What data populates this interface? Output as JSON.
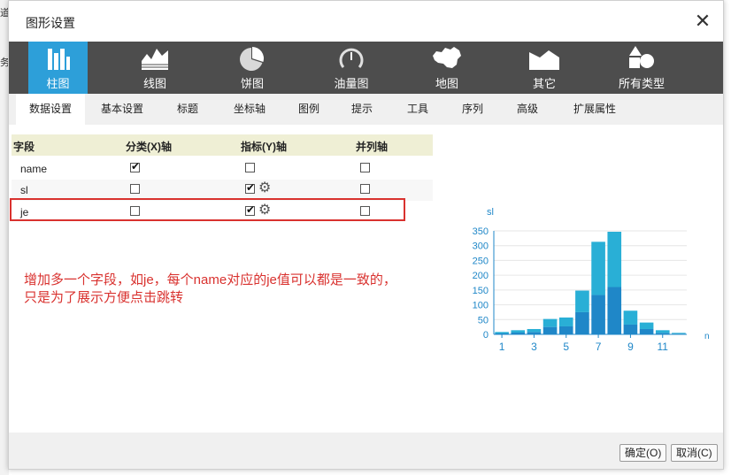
{
  "background": {
    "fragment_top": "道",
    "fragment_mid": "务"
  },
  "dialog": {
    "title": "图形设置",
    "close_icon": "close-icon",
    "chart_types": [
      {
        "label": "柱图",
        "icon": "bar-chart-icon",
        "active": true
      },
      {
        "label": "线图",
        "icon": "line-chart-icon",
        "active": false
      },
      {
        "label": "饼图",
        "icon": "pie-chart-icon",
        "active": false
      },
      {
        "label": "油量图",
        "icon": "gauge-icon",
        "active": false
      },
      {
        "label": "地图",
        "icon": "map-icon",
        "active": false
      },
      {
        "label": "其它",
        "icon": "other-chart-icon",
        "active": false
      },
      {
        "label": "所有类型",
        "icon": "all-types-icon",
        "active": false
      }
    ],
    "tabs": [
      "数据设置",
      "基本设置",
      "标题",
      "坐标轴",
      "图例",
      "提示",
      "工具",
      "序列",
      "高级",
      "扩展属性"
    ],
    "active_tab": "数据设置",
    "grid": {
      "headers": [
        "字段",
        "分类(X)轴",
        "指标(Y)轴",
        "并列轴"
      ],
      "rows": [
        {
          "field": "name",
          "x_axis": true,
          "y_axis": false,
          "parallel": false,
          "gear": false
        },
        {
          "field": "sl",
          "x_axis": false,
          "y_axis": true,
          "parallel": false,
          "gear": true
        },
        {
          "field": "je",
          "x_axis": false,
          "y_axis": true,
          "parallel": false,
          "gear": true
        }
      ]
    },
    "note_line1": "增加多一个字段，如je，每个name对应的je值可以都是一致的，",
    "note_line2": "只是为了展示方便点击跳转",
    "highlight_color": "#d9322f",
    "buttons": {
      "ok": "确定(O)",
      "cancel": "取消(C)"
    }
  },
  "chart_data": {
    "type": "bar",
    "ylabel": "sl",
    "xlabel": "n",
    "categories": [
      1,
      2,
      3,
      4,
      5,
      6,
      7,
      8,
      9,
      10,
      11,
      12
    ],
    "x_tick_labels": [
      "1",
      "3",
      "5",
      "7",
      "9",
      "11"
    ],
    "y_ticks": [
      "0",
      "50",
      "100",
      "150",
      "200",
      "250",
      "300",
      "350"
    ],
    "ylim": [
      0,
      350
    ],
    "series": [
      {
        "values": [
          3,
          6,
          8,
          25,
          27,
          75,
          133,
          160,
          33,
          18,
          5,
          2
        ],
        "color": "#1f87c8"
      },
      {
        "values": [
          5,
          8,
          10,
          27,
          30,
          73,
          180,
          187,
          47,
          22,
          9,
          3
        ],
        "color": "#29afd6"
      }
    ],
    "grid": true,
    "stacked": true
  }
}
